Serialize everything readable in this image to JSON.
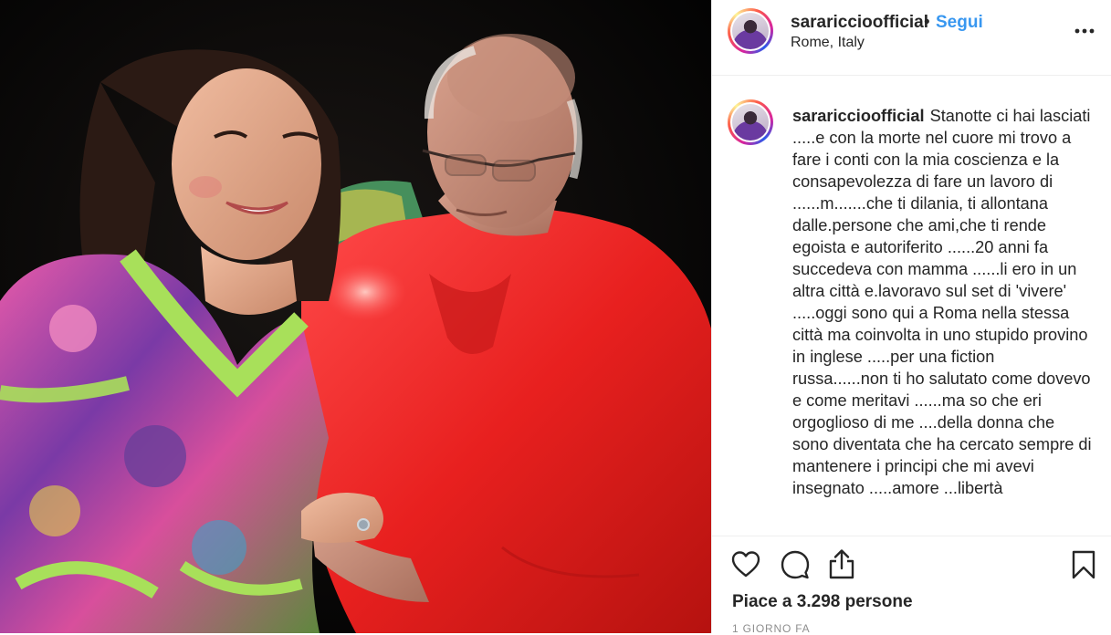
{
  "header": {
    "username": "sarariccioofficial",
    "separator": "•",
    "follow_label": "Segui",
    "location": "Rome, Italy",
    "more_icon": "more-horizontal-icon"
  },
  "caption": {
    "username": "sarariccioofficial",
    "text": "Stanotte ci hai lasciati .....e con la morte nel cuore mi trovo a fare i conti con la mia coscienza e la consapevolezza di fare un lavoro di ......m.......che ti dilania, ti allontana dalle.persone che ami,che ti rende egoista e autoriferito ......20 anni fa succedeva con mamma ......li ero in un altra città e.lavoravo sul set di 'vivere' .....oggi sono qui a Roma nella stessa città ma coinvolta in uno stupido provino in inglese .....per una fiction russa......non ti ho salutato come dovevo e come meritavi ......ma so che eri orgoglioso di me ....della donna che sono diventata che ha cercato sempre di mantenere i principi che mi avevi insegnato .....amore ...libertà"
  },
  "actions": {
    "like_icon": "heart-icon",
    "comment_icon": "comment-icon",
    "share_icon": "share-icon",
    "save_icon": "bookmark-icon"
  },
  "likes_text": "Piace a 3.298 persone",
  "timestamp": "1 GIORNO FA",
  "colors": {
    "follow": "#3897f0",
    "text": "#262626",
    "muted": "#8e8e8e",
    "divider": "#efefef"
  }
}
